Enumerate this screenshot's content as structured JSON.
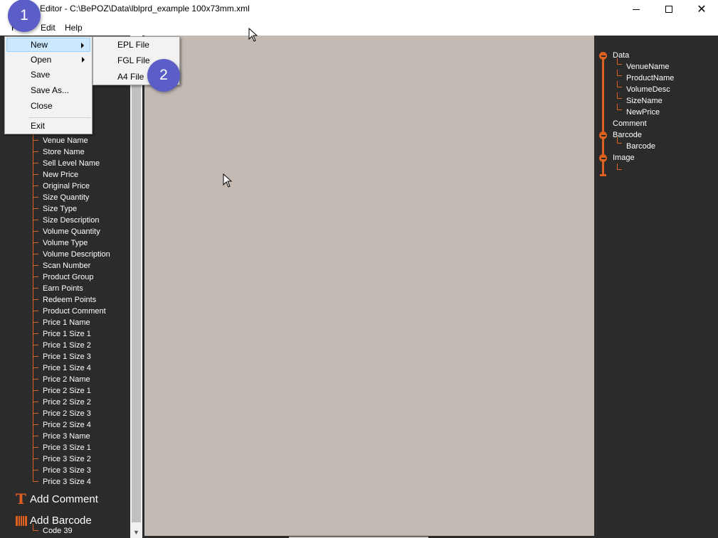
{
  "window": {
    "title": "Editor - C:\\BePOZ\\Data\\lblprd_example 100x73mm.xml",
    "minimize_label": "minimize",
    "maximize_label": "maximize",
    "close_glyph": "✕"
  },
  "menubar": {
    "file_label": "F",
    "edit_label": "Edit",
    "help_label": "Help"
  },
  "file_menu": {
    "items": [
      "New",
      "Open",
      "Save",
      "Save As...",
      "Close",
      "Exit"
    ]
  },
  "new_submenu": {
    "items": [
      "EPL File",
      "FGL File",
      "A4 File"
    ]
  },
  "badges": {
    "step1": "1",
    "step2": "2"
  },
  "field_list": {
    "items": [
      "Venue Name",
      "Store Name",
      "Sell Level Name",
      "New Price",
      "Original Price",
      "Size Quantity",
      "Size Type",
      "Size Description",
      "Volume Quantity",
      "Volume Type",
      "Volume Description",
      "Scan Number",
      "Product Group",
      "Earn Points",
      "Redeem Points",
      "Product Comment",
      "Price 1 Name",
      "Price 1 Size 1",
      "Price 1 Size 2",
      "Price 1 Size 3",
      "Price 1 Size 4",
      "Price 2 Name",
      "Price 2 Size 1",
      "Price 2 Size 2",
      "Price 2 Size 3",
      "Price 2 Size 4",
      "Price 3 Name",
      "Price 3 Size 1",
      "Price 3 Size 2",
      "Price 3 Size 3",
      "Price 3 Size 4"
    ]
  },
  "tools": {
    "add_comment": "Add Comment",
    "add_barcode": "Add Barcode",
    "barcode_type": "Code 39"
  },
  "structure_tree": {
    "data": "Data",
    "data_children": [
      "VenueName",
      "ProductName",
      "VolumeDesc",
      "SizeName",
      "NewPrice"
    ],
    "comment": "Comment",
    "barcode": "Barcode",
    "barcode_children": [
      "Barcode"
    ],
    "image": "Image"
  },
  "colors": {
    "accent": "#e06020",
    "panel": "#2b2b2b",
    "canvas": "#c3bab3",
    "badge": "#5b5ec7",
    "menu_highlight": "#cce8ff"
  }
}
